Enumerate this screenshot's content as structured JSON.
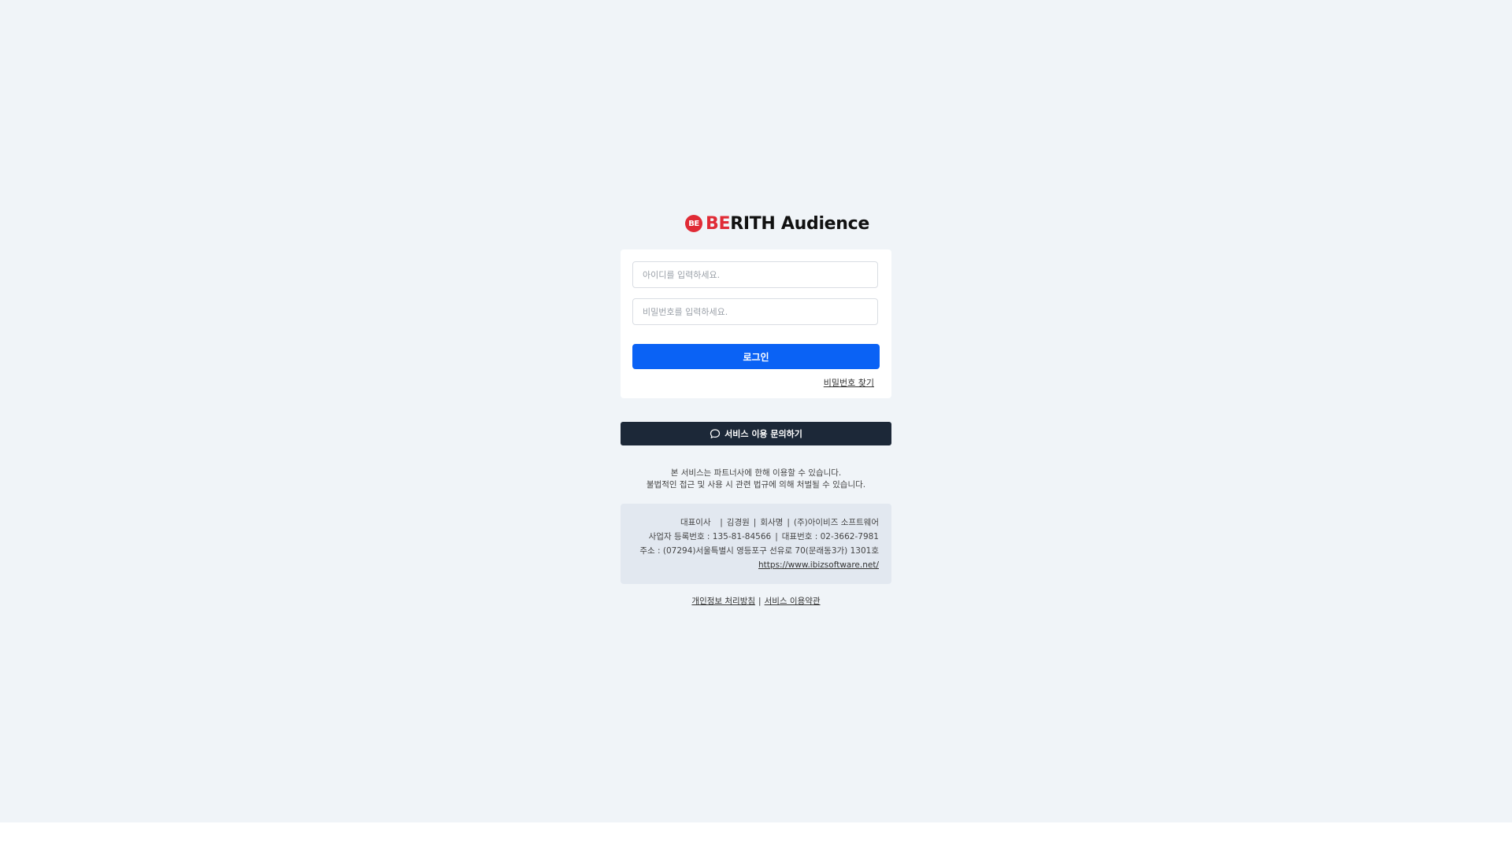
{
  "brand": {
    "logo_mark": "BE",
    "name_prefix": "BE",
    "name_rest": "RITH Audience",
    "accent_color": "#e02b36"
  },
  "login": {
    "id_placeholder": "아이디를 입력하세요.",
    "password_placeholder": "비밀번호를 입력하세요.",
    "login_label": "로그인",
    "find_password_label": "비밀번호 찾기",
    "button_color": "#0a62f5"
  },
  "inquiry": {
    "icon": "chat-bubble-icon",
    "label": "서비스 이용 문의하기"
  },
  "notice": {
    "line1": "본 서비스는 파트너사에 한해 이용할 수 있습니다.",
    "line2": "불법적인 접근 및 사용 시 관련 법규에 의해 처벌될 수 있습니다."
  },
  "company": {
    "ceo_label": "대표이사",
    "ceo_name": "김경원",
    "company_label": "회사명",
    "company_name": "(주)아이비즈 소프트웨어",
    "business_number": "사업자 등록번호 : 135-81-84566",
    "phone": "대표번호 : 02-3662-7981",
    "address": "주소 : (07294)서울특별시 영등포구 선유로 70(문래동3가) 1301호",
    "website": "https://www.ibizsoftware.net/"
  },
  "footer": {
    "privacy_label": "개인정보 처리방침",
    "divider": "|",
    "terms_label": "서비스 이용약관"
  }
}
